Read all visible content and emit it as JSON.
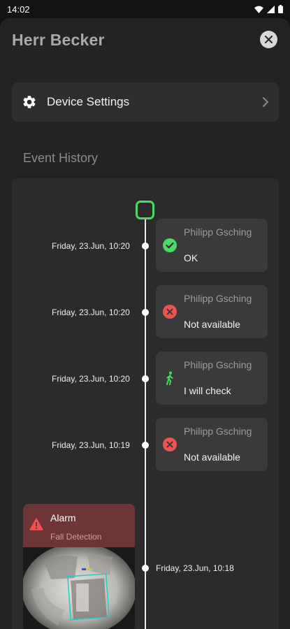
{
  "status_bar": {
    "time": "14:02"
  },
  "sheet": {
    "title": "Herr Becker"
  },
  "settings": {
    "label": "Device Settings"
  },
  "history": {
    "title": "Event History",
    "events": [
      {
        "timestamp": "Friday, 23.Jun, 10:20",
        "name": "Philipp Gsching",
        "status": "OK",
        "icon": "check-circle-icon",
        "color": "#4cd964"
      },
      {
        "timestamp": "Friday, 23.Jun, 10:20",
        "name": "Philipp Gsching",
        "status": "Not available",
        "icon": "x-circle-icon",
        "color": "#ef5350"
      },
      {
        "timestamp": "Friday, 23.Jun, 10:20",
        "name": "Philipp Gsching",
        "status": "I will check",
        "icon": "walking-person-icon",
        "color": "#4cd964"
      },
      {
        "timestamp": "Friday, 23.Jun, 10:19",
        "name": "Philipp Gsching",
        "status": "Not available",
        "icon": "x-circle-icon",
        "color": "#ef5350"
      }
    ],
    "alarm": {
      "timestamp": "Friday, 23.Jun, 10:18",
      "title": "Alarm",
      "subtitle": "Fall Detection",
      "icon": "warning-triangle-icon",
      "color": "#ef5350"
    }
  },
  "colors": {
    "accent_green": "#4cd964",
    "error_red": "#ef5350",
    "alarm_bg": "#6d3535"
  }
}
